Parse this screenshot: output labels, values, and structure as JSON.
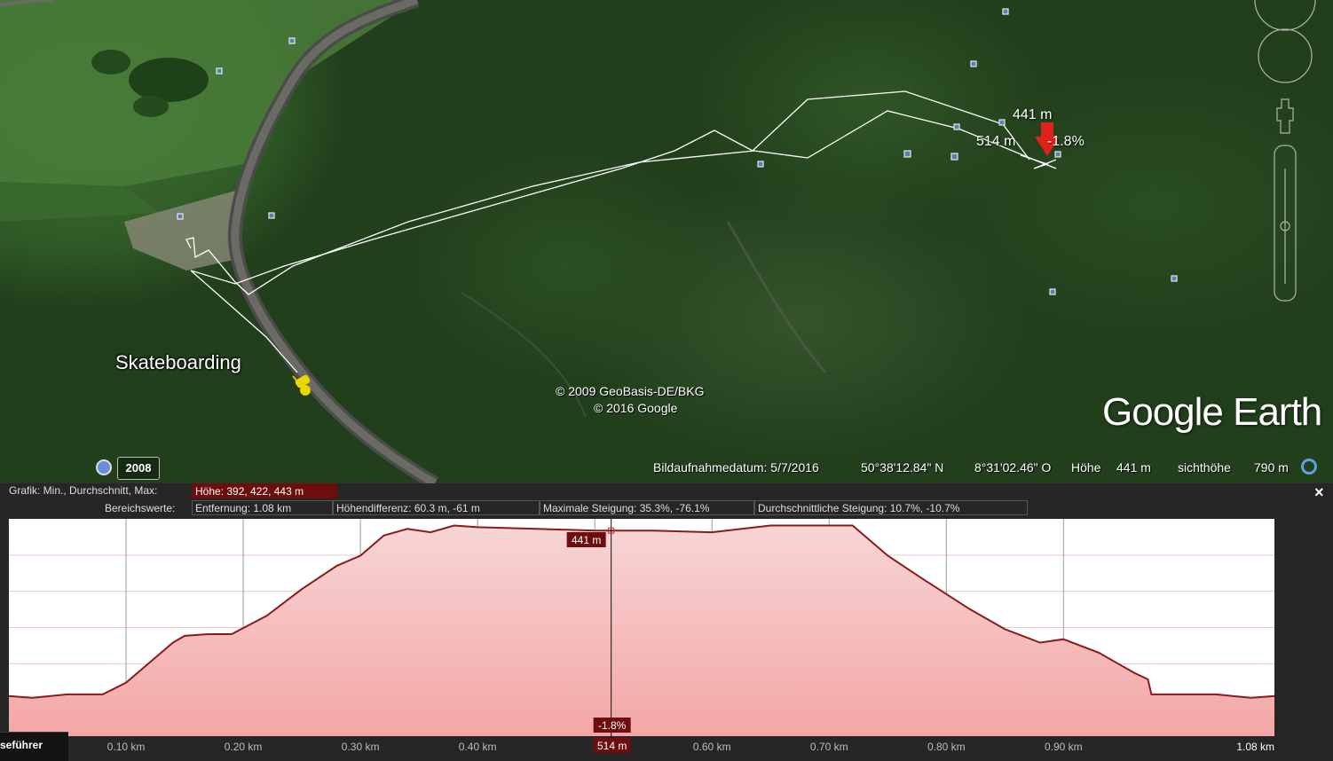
{
  "map": {
    "placemark_label": "Skateboarding",
    "copyright_line1": "© 2009 GeoBasis-DE/BKG",
    "copyright_line2": "© 2016 Google",
    "logo": "Google Earth",
    "hud": {
      "elevation": "441 m",
      "distance": "514 m",
      "grade": "-1.8%"
    },
    "placemark_icon": "yellow-pushpin-icon"
  },
  "statusbar": {
    "historical_year": "2008",
    "image_date": "Bildaufnahmedatum: 5/7/2016",
    "latitude": "50°38'12.84\" N",
    "longitude": "8°31'02.46\" O",
    "elevation_label": "Höhe",
    "elevation_value": "441 m",
    "eye_alt_label": "sichthöhe",
    "eye_alt_value": "790 m"
  },
  "profile": {
    "graph_label": "Grafik: Min., Durchschnitt, Max:",
    "graph_value": "Höhe: 392, 422, 443 m",
    "range_label": "Bereichswerte:",
    "range_distance": "Entfernung: 1.08 km",
    "range_height_diff": "Höhendifferenz: 60.3 m, -61 m",
    "range_max_slope": "Maximale Steigung: 35.3%, -76.1%",
    "range_avg_slope": "Durchschnittliche Steigung: 10.7%, -10.7%",
    "close_label": "×",
    "cursor_elevation": "441 m",
    "cursor_grade": "-1.8%",
    "cursor_distance": "514 m",
    "x_ticks": [
      "0.10 km",
      "0.20 km",
      "0.30 km",
      "0.40 km",
      "0.60 km",
      "0.70 km",
      "0.80 km",
      "0.90 km"
    ],
    "x_end": "1.08 km"
  },
  "tour_tab": "seführer",
  "chart_data": {
    "type": "area",
    "x_unit": "km",
    "y_unit": "m",
    "xlim": [
      0,
      1.08
    ],
    "ylim": [
      380,
      445
    ],
    "cursor_x": 0.514,
    "series": [
      {
        "x": [
          0,
          0.02,
          0.05,
          0.08,
          0.1,
          0.14,
          0.15,
          0.17,
          0.19,
          0.22,
          0.25,
          0.28,
          0.3,
          0.32,
          0.34,
          0.36,
          0.38,
          0.4,
          0.45,
          0.5,
          0.55,
          0.6,
          0.65,
          0.68,
          0.72,
          0.75,
          0.78,
          0.82,
          0.85,
          0.88,
          0.9,
          0.93,
          0.96,
          0.972,
          0.975,
          1.0,
          1.03,
          1.06,
          1.08
        ],
        "y": [
          392,
          391.5,
          392.5,
          392.5,
          396,
          408,
          410,
          410.5,
          410.5,
          416,
          424,
          431,
          434,
          440,
          442,
          441,
          443,
          442.5,
          442,
          441.5,
          441.5,
          441,
          443,
          443,
          443,
          434,
          427,
          418,
          412,
          408,
          409,
          405,
          399,
          397,
          392.5,
          392.5,
          392.5,
          391.5,
          392
        ]
      }
    ]
  }
}
